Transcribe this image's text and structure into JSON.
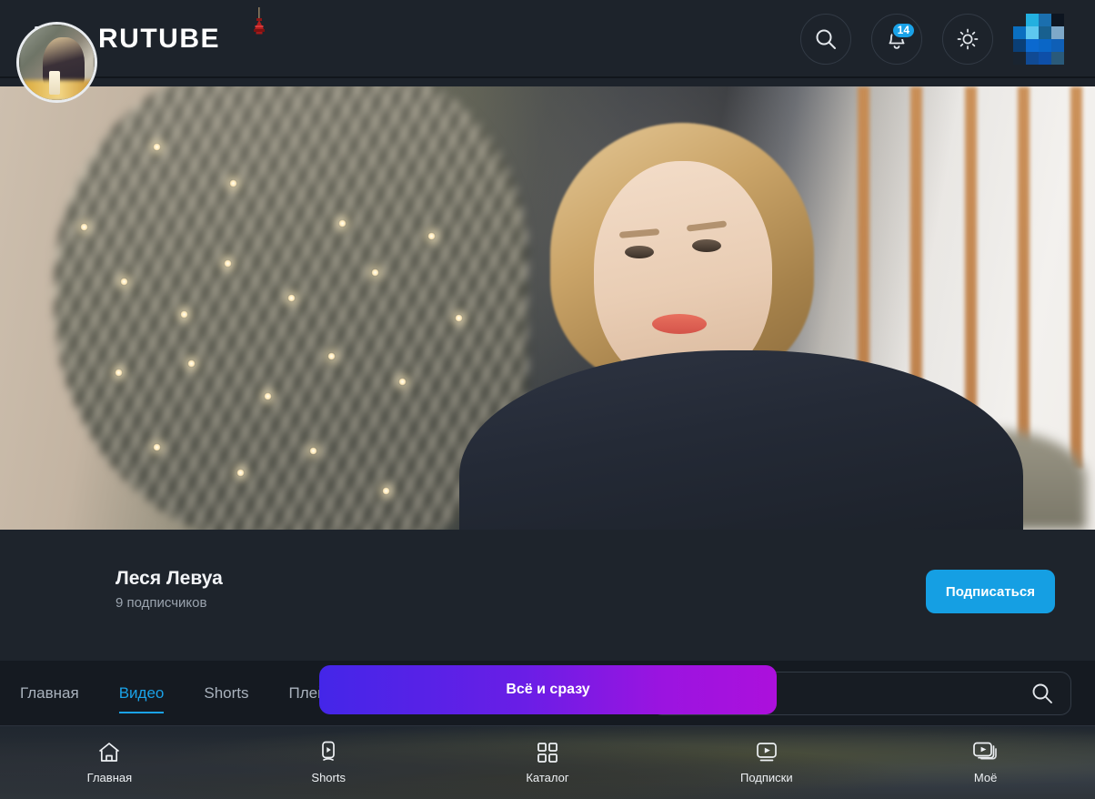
{
  "header": {
    "menu_label": "menu",
    "logo_text": "RUTUBE",
    "search_icon": "search-icon",
    "notifications_icon": "bell-icon",
    "notifications_count": "14",
    "theme_icon": "sun-icon",
    "avatar_label": "user-avatar"
  },
  "banner": {
    "alt": "Woman in front of a decorated Christmas tree"
  },
  "channel": {
    "name": "Леся Левуа",
    "subscribers": "9 подписчиков",
    "subscribe_label": "Подписаться",
    "avatar_label": "channel-avatar"
  },
  "tabs": [
    {
      "label": "Главная",
      "active": false
    },
    {
      "label": "Видео",
      "active": true
    },
    {
      "label": "Shorts",
      "active": false
    },
    {
      "label": "Плейлисты",
      "active": false
    }
  ],
  "channel_search": {
    "value": "",
    "placeholder": "",
    "icon": "search-icon"
  },
  "promo": {
    "label": "Всё и сразу"
  },
  "bottom_nav": [
    {
      "label": "Главная",
      "icon": "home-icon"
    },
    {
      "label": "Shorts",
      "icon": "shorts-icon"
    },
    {
      "label": "Каталог",
      "icon": "grid-icon"
    },
    {
      "label": "Подписки",
      "icon": "subscriptions-icon"
    },
    {
      "label": "Моё",
      "icon": "my-videos-icon"
    }
  ],
  "colors": {
    "header_bg": "#1d232b",
    "channel_bg": "#1e242c",
    "tabs_bg": "#151a21",
    "accent_blue": "#1aa2e8",
    "subscribe_blue": "#159fe3",
    "promo_from": "#4426e8",
    "promo_to": "#ac10dc",
    "badge_blue": "#1aa2e8"
  }
}
